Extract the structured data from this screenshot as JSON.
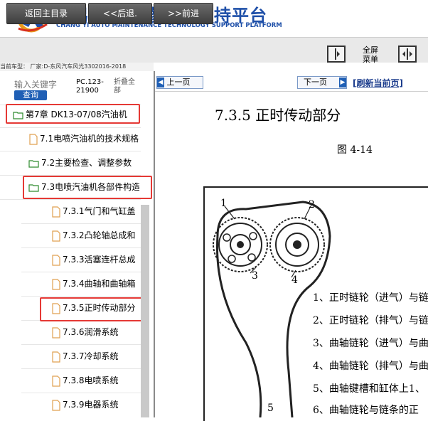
{
  "header": {
    "brand_cn": "畅易汽车维修技术支持平台",
    "brand_en": "CHANG YI AUTO MAINTENANCE TECHNOLOGY SUPPORT PLATFORM",
    "accent": "#1e4fa8"
  },
  "toolbar": {
    "home_label": "返回主目录",
    "back_label": "<<后退.",
    "forward_label": ">>前进",
    "fullscreen_label": "全屏",
    "menu_label": "菜单"
  },
  "infobar": {
    "text": "当前车型： 厂家:D-东风汽车风光3302016-2018"
  },
  "sidebar": {
    "search_placeholder": "输入关键字",
    "search_button": "查询",
    "model_code": "PC.123-21900",
    "collapse_all": "折叠全部",
    "items": [
      {
        "label": "第7章 DK13-07/08汽油机",
        "type": "folder-open"
      },
      {
        "label": "7.1电喷汽油机的技术规格",
        "type": "doc"
      },
      {
        "label": "7.2主要检查、调整参数",
        "type": "folder"
      },
      {
        "label": "7.3电喷汽油机各部件构造",
        "type": "folder-open"
      },
      {
        "label": "7.3.1气门和气缸盖",
        "type": "doc"
      },
      {
        "label": "7.3.2凸轮轴总成和",
        "type": "doc"
      },
      {
        "label": "7.3.3活塞连杆总成",
        "type": "doc"
      },
      {
        "label": "7.3.4曲轴和曲轴箱",
        "type": "doc"
      },
      {
        "label": "7.3.5正时传动部分",
        "type": "doc"
      },
      {
        "label": "7.3.6润滑系统",
        "type": "doc"
      },
      {
        "label": "7.3.7冷却系统",
        "type": "doc"
      },
      {
        "label": "7.3.8电喷系统",
        "type": "doc"
      },
      {
        "label": "7.3.9电器系统",
        "type": "doc"
      }
    ],
    "highlight_color": "#e53935"
  },
  "content": {
    "prev_page": "上一页",
    "next_page": "下一页",
    "refresh": "[刷新当前页]",
    "section_title": "7.3.5 正时传动部分",
    "figure_label": "图 4-14",
    "callouts": [
      "1",
      "2",
      "3",
      "4",
      "5"
    ],
    "legend": [
      "1、正时链轮（进气）与链",
      "2、正时链轮（排气）与链",
      "3、曲轴链轮（进气）与曲",
      "4、曲轴链轮（排气）与曲",
      "5、曲轴键槽和缸体上1、",
      "6、曲轴链轮与链条的正"
    ]
  }
}
